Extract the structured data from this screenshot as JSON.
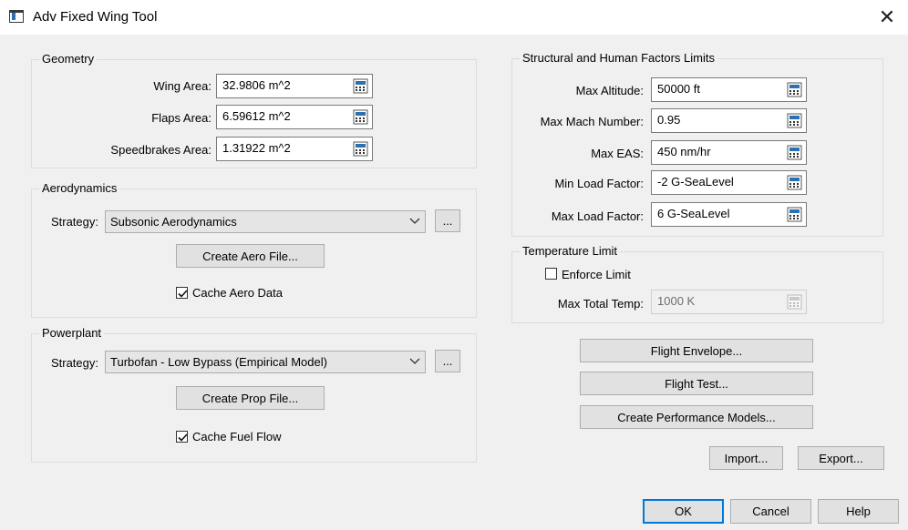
{
  "window": {
    "title": "Adv Fixed Wing Tool",
    "close_glyph": "✕"
  },
  "geometry": {
    "title": "Geometry",
    "wing_area_label": "Wing Area:",
    "wing_area_value": "32.9806 m^2",
    "flaps_area_label": "Flaps Area:",
    "flaps_area_value": "6.59612 m^2",
    "speedbrakes_area_label": "Speedbrakes Area:",
    "speedbrakes_area_value": "1.31922 m^2"
  },
  "aerodynamics": {
    "title": "Aerodynamics",
    "strategy_label": "Strategy:",
    "strategy_value": "Subsonic Aerodynamics",
    "ellipsis": "...",
    "create_button": "Create Aero File...",
    "cache_label": "Cache Aero Data",
    "cache_checked": true
  },
  "powerplant": {
    "title": "Powerplant",
    "strategy_label": "Strategy:",
    "strategy_value": "Turbofan - Low Bypass (Empirical Model)",
    "ellipsis": "...",
    "create_button": "Create Prop File...",
    "cache_label": "Cache Fuel Flow",
    "cache_checked": true
  },
  "structural": {
    "title": "Structural and Human Factors Limits",
    "max_altitude_label": "Max Altitude:",
    "max_altitude_value": "50000 ft",
    "max_mach_label": "Max Mach Number:",
    "max_mach_value": "0.95",
    "max_eas_label": "Max EAS:",
    "max_eas_value": "450 nm/hr",
    "min_load_label": "Min Load Factor:",
    "min_load_value": "-2 G-SeaLevel",
    "max_load_label": "Max Load Factor:",
    "max_load_value": "6 G-SeaLevel"
  },
  "temperature": {
    "title": "Temperature Limit",
    "enforce_label": "Enforce Limit",
    "enforce_checked": false,
    "max_temp_label": "Max Total Temp:",
    "max_temp_value": "1000 K"
  },
  "actions": {
    "flight_envelope": "Flight Envelope...",
    "flight_test": "Flight Test...",
    "create_perf_models": "Create Performance Models...",
    "import": "Import...",
    "export": "Export..."
  },
  "footer": {
    "ok": "OK",
    "cancel": "Cancel",
    "help": "Help"
  },
  "colors": {
    "accent": "#0078d7",
    "calc_icon": "#2b6fb5"
  },
  "icons": {
    "field_button": "calculator-icon",
    "dropdown": "chevron-down-icon"
  }
}
